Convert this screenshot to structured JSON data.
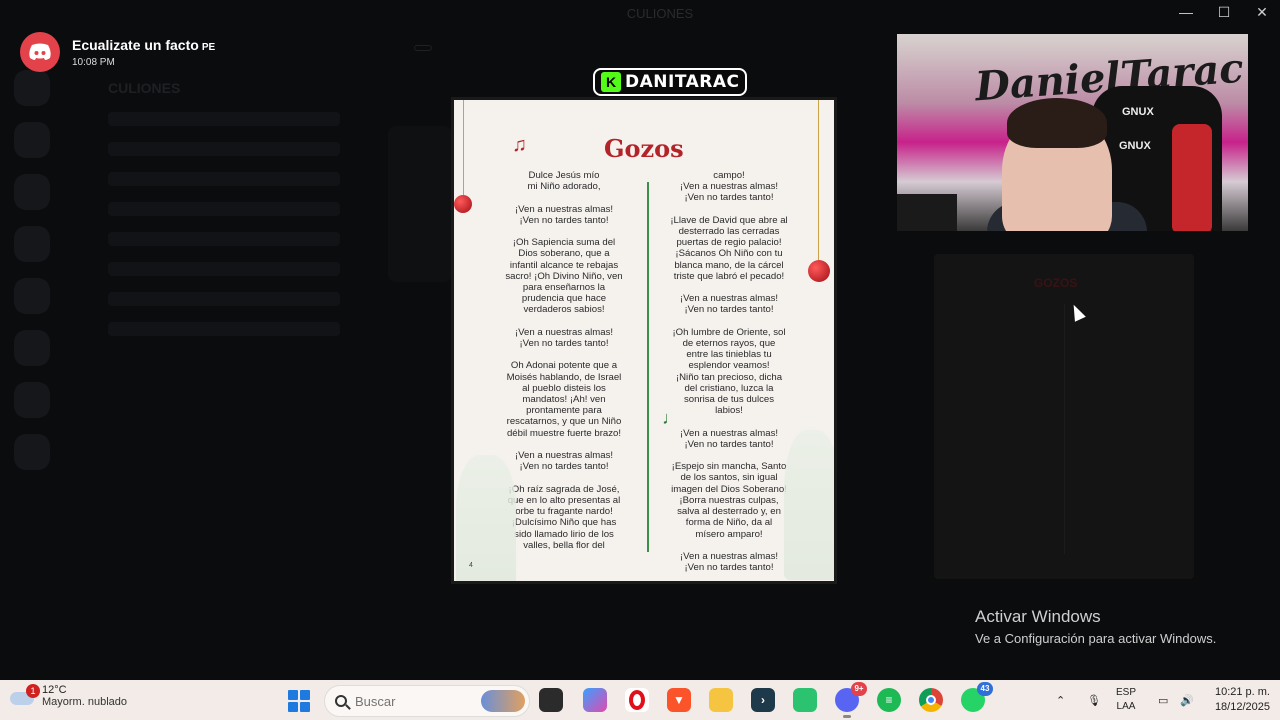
{
  "window": {
    "title": "CULIONES"
  },
  "notification": {
    "app": "Discord",
    "title": "Ecualizate un facto",
    "tag": "PE",
    "time": "10:08 PM"
  },
  "stream_label": {
    "platform_icon": "K",
    "name": "DANITARAC"
  },
  "document": {
    "title": "Gozos",
    "note_symbol": "♫",
    "page_number": "4",
    "left_column": "Dulce Jesús mío\nmi Niño adorado,\n\n¡Ven a nuestras almas!\n¡Ven no tardes tanto!\n\n¡Oh Sapiencia suma del\nDios soberano, que a\ninfantil alcance te rebajas\nsacro! ¡Oh Divino Niño, ven\npara enseñarnos la\nprudencia que hace\nverdaderos sabios!\n\n¡Ven a nuestras almas!\n¡Ven no tardes tanto!\n\nOh Adonai potente que a\nMoisés hablando, de Israel\nal pueblo disteis los\nmandatos! ¡Ah! ven\nprontamente para\nrescatarnos, y que un Niño\ndébil muestre fuerte brazo!\n\n¡Ven a nuestras almas!\n¡Ven no tardes tanto!\n\n¡Oh raíz sagrada de José,\nque en lo alto presentas al\norbe tu fragante nardo!\n¡Dulcísimo Niño que has\nsido llamado lirio de los\nvalles, bella flor del",
    "right_column": "campo!\n¡Ven a nuestras almas!\n¡Ven no tardes tanto!\n\n¡Llave de David que abre al\ndesterrado las cerradas\npuertas de regio palacio!\n¡Sácanos Oh Niño con tu\nblanca mano, de la cárcel\ntriste que labró el pecado!\n\n¡Ven a nuestras almas!\n¡Ven no tardes tanto!\n\n¡Oh lumbre de Oriente, sol\nde eternos rayos, que\nentre las tinieblas tu\nesplendor veamos!\n¡Niño tan precioso, dicha\ndel cristiano, luzca la\nsonrisa de tus dulces\nlabios!\n\n¡Ven a nuestras almas!\n¡Ven no tardes tanto!\n\n¡Espejo sin mancha, Santo\nde los santos, sin igual\nimagen del Dios Soberano!\n¡Borra nuestras culpas,\nsalva al desterrado y, en\nforma de Niño, da al\nmísero amparo!\n\n¡Ven a nuestras almas!\n¡Ven no tardes tanto!"
  },
  "webcam": {
    "graffiti_text": "DanielTarac",
    "chair_label_1": "GNUX",
    "chair_label_2": "GNUX"
  },
  "preview": {
    "title": "GOZOS"
  },
  "watermark": {
    "title": "Activar Windows",
    "subtitle": "Ve a Configuración para activar Windows."
  },
  "taskbar": {
    "weather": {
      "temp": "12°C",
      "desc": "Mayorm. nublado",
      "badge": "1"
    },
    "search_placeholder": "Buscar",
    "apps": [
      {
        "name": "file-explorer-dark",
        "badge": ""
      },
      {
        "name": "copilot",
        "badge": ""
      },
      {
        "name": "opera",
        "badge": ""
      },
      {
        "name": "brave",
        "badge": ""
      },
      {
        "name": "folder",
        "badge": ""
      },
      {
        "name": "terminal",
        "badge": ""
      },
      {
        "name": "app-green",
        "badge": ""
      },
      {
        "name": "discord",
        "badge": "9+"
      },
      {
        "name": "spotify",
        "badge": ""
      },
      {
        "name": "chrome",
        "badge": ""
      },
      {
        "name": "whatsapp",
        "badge": "43"
      }
    ],
    "lang_1": "ESP",
    "lang_2": "LAA",
    "time": "10:21 p. m.",
    "date": "18/12/2025"
  },
  "colors": {
    "discord": "#e3424a",
    "kick_green": "#53fc18",
    "doc_red": "#b3242a",
    "doc_green": "#3a8f4a",
    "taskbar_bg": "#f3ebe7"
  }
}
